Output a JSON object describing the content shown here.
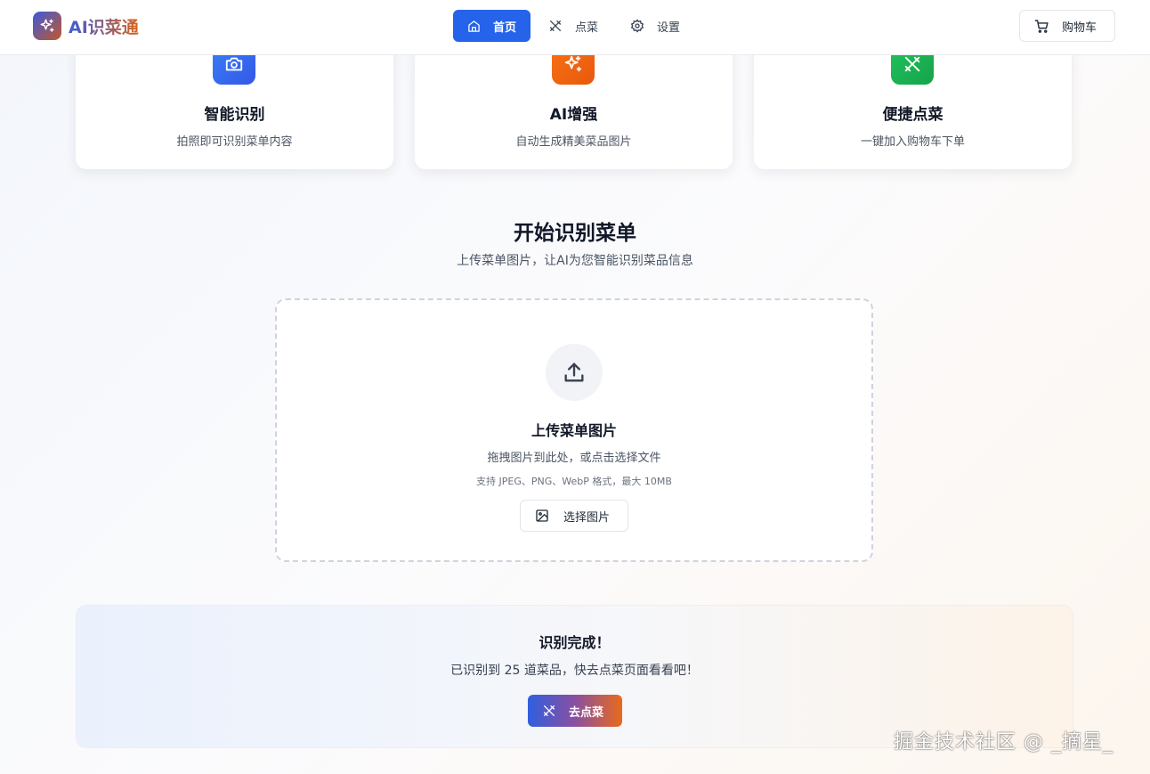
{
  "header": {
    "logo_text": "AI识菜通",
    "nav": [
      {
        "label": "首页",
        "icon": "home-icon",
        "active": true
      },
      {
        "label": "点菜",
        "icon": "utensils-icon",
        "active": false
      },
      {
        "label": "设置",
        "icon": "gear-icon",
        "active": false
      }
    ],
    "cart_label": "购物车"
  },
  "features": [
    {
      "title": "智能识别",
      "desc": "拍照即可识别菜单内容",
      "icon": "camera-icon",
      "color": "#3b6ff0"
    },
    {
      "title": "AI增强",
      "desc": "自动生成精美菜品图片",
      "icon": "sparkles-icon",
      "color": "#f06a17"
    },
    {
      "title": "便捷点菜",
      "desc": "一键加入购物车下单",
      "icon": "utensils-icon",
      "color": "#1fbf5a"
    }
  ],
  "upload": {
    "title": "开始识别菜单",
    "subtitle": "上传菜单图片，让AI为您智能识别菜品信息",
    "box_title": "上传菜单图片",
    "hint": "拖拽图片到此处，或点击选择文件",
    "formats": "支持 JPEG、PNG、WebP 格式，最大 10MB",
    "choose_label": "选择图片"
  },
  "result": {
    "title": "识别完成！",
    "desc": "已识别到 25 道菜品，快去点菜页面看看吧！",
    "button_label": "去点菜"
  },
  "watermark": "掘金技术社区 @ _摘星_"
}
